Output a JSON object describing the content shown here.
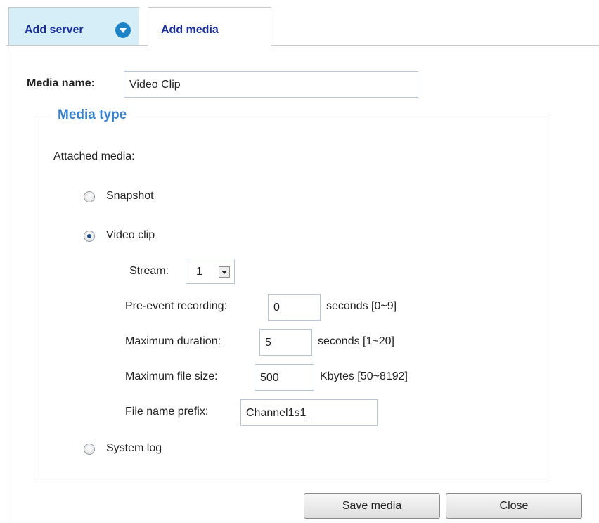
{
  "tabs": [
    {
      "label": "Add server",
      "active": false
    },
    {
      "label": "Add media",
      "active": true
    }
  ],
  "media_name": {
    "label": "Media name:",
    "value": "Video Clip"
  },
  "media_type": {
    "legend": "Media type",
    "attached_label": "Attached media:",
    "options": [
      {
        "label": "Snapshot",
        "selected": false
      },
      {
        "label": "Video clip",
        "selected": true
      },
      {
        "label": "System log",
        "selected": false
      }
    ],
    "video": {
      "stream_label": "Stream:",
      "stream_value": "1",
      "pre_event_label": "Pre-event recording:",
      "pre_event_value": "0",
      "pre_event_unit": "seconds [0~9]",
      "max_duration_label": "Maximum duration:",
      "max_duration_value": "5",
      "max_duration_unit": "seconds [1~20]",
      "max_size_label": "Maximum file size:",
      "max_size_value": "500",
      "max_size_unit": "Kbytes [50~8192]",
      "prefix_label": "File name prefix:",
      "prefix_value": "Channel1s1_"
    }
  },
  "buttons": {
    "save": "Save media",
    "close": "Close"
  },
  "colors": {
    "link": "#1a2f9e",
    "legend": "#3a83cc",
    "active_tab_bg": "#d6eef7",
    "dropdown_icon": "#1c84c6"
  },
  "icons": {
    "tab_dropdown": "chevron-down-circle-icon",
    "select_arrow": "triangle-down-icon"
  }
}
